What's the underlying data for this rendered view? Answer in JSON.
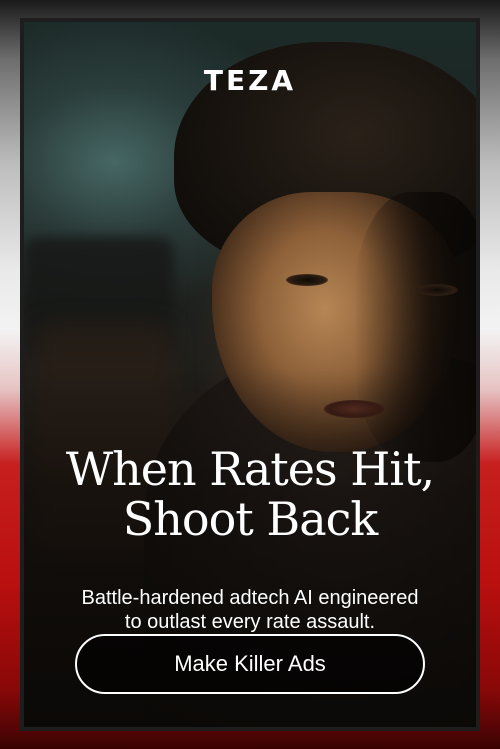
{
  "brand": {
    "logo_text": "TEZA"
  },
  "headline": {
    "line1": "When Rates Hit,",
    "line2": "Shoot Back"
  },
  "subcopy": {
    "line1": "Battle-hardened adtech AI engineered",
    "line2": "to outlast every rate assault."
  },
  "cta": {
    "label": "Make Killer Ads"
  },
  "colors": {
    "border_top": "#e9e9e9",
    "border_bottom": "#c71e1e",
    "text": "#ffffff"
  }
}
